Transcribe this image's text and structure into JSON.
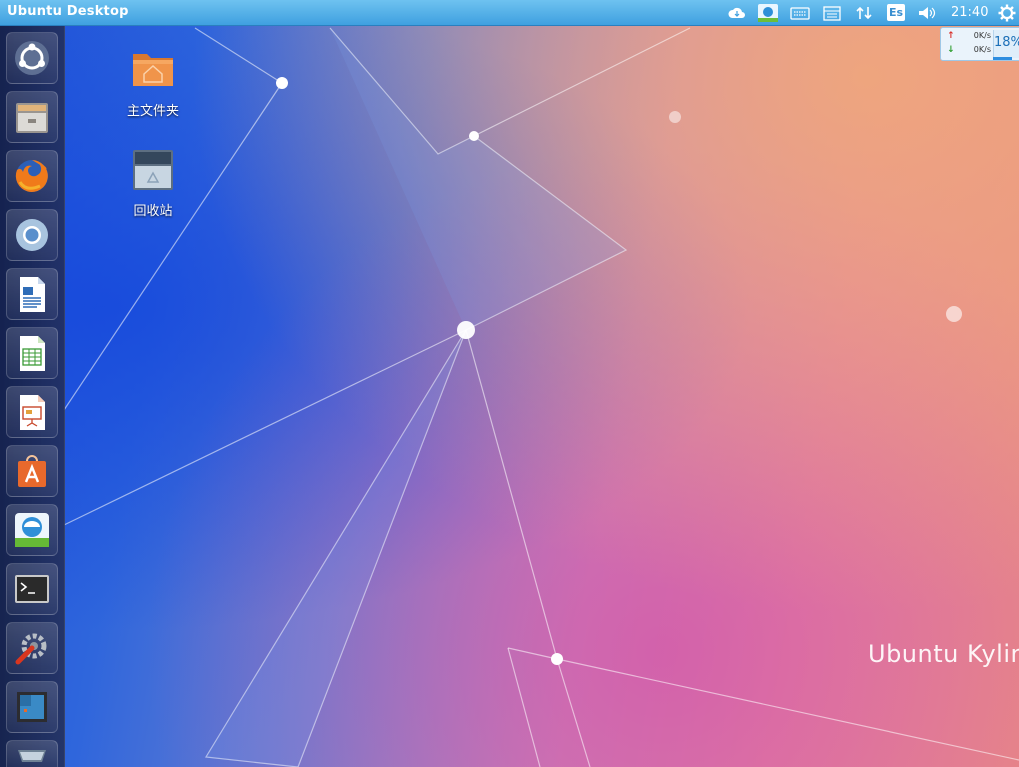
{
  "panel": {
    "title": "Ubuntu Desktop",
    "clock": "21:40",
    "tray_icons": [
      "cloud-icon",
      "kylin-assistant-icon",
      "keyboard-icon",
      "calendar-icon",
      "network-transfer-icon",
      "language-indicator-icon",
      "volume-icon",
      "power-gear-icon"
    ],
    "language_code": "Es"
  },
  "net_monitor": {
    "upload": "0K/s",
    "download": "0K/s",
    "usage": "18%",
    "usage_fraction": 0.18
  },
  "launcher": {
    "items": [
      "ubuntu-dash-icon",
      "files-icon",
      "firefox-icon",
      "chromium-icon",
      "libreoffice-writer-icon",
      "libreoffice-calc-icon",
      "libreoffice-impress-icon",
      "software-center-icon",
      "kylin-assistant-icon",
      "terminal-icon",
      "system-settings-icon",
      "workspace-switcher-icon",
      "trash-icon"
    ]
  },
  "desktop": {
    "icons": [
      {
        "label": "主文件夹",
        "icon": "home-folder-icon"
      },
      {
        "label": "回收站",
        "icon": "trash-icon"
      }
    ],
    "watermark": "Ubuntu Kylin"
  },
  "colors": {
    "panel": "#4aa8e6",
    "launcher": "#1c2448",
    "wallpaper_left": "#1f52d9",
    "wallpaper_right": "#ea8f82",
    "accent": "#1d70b8"
  }
}
